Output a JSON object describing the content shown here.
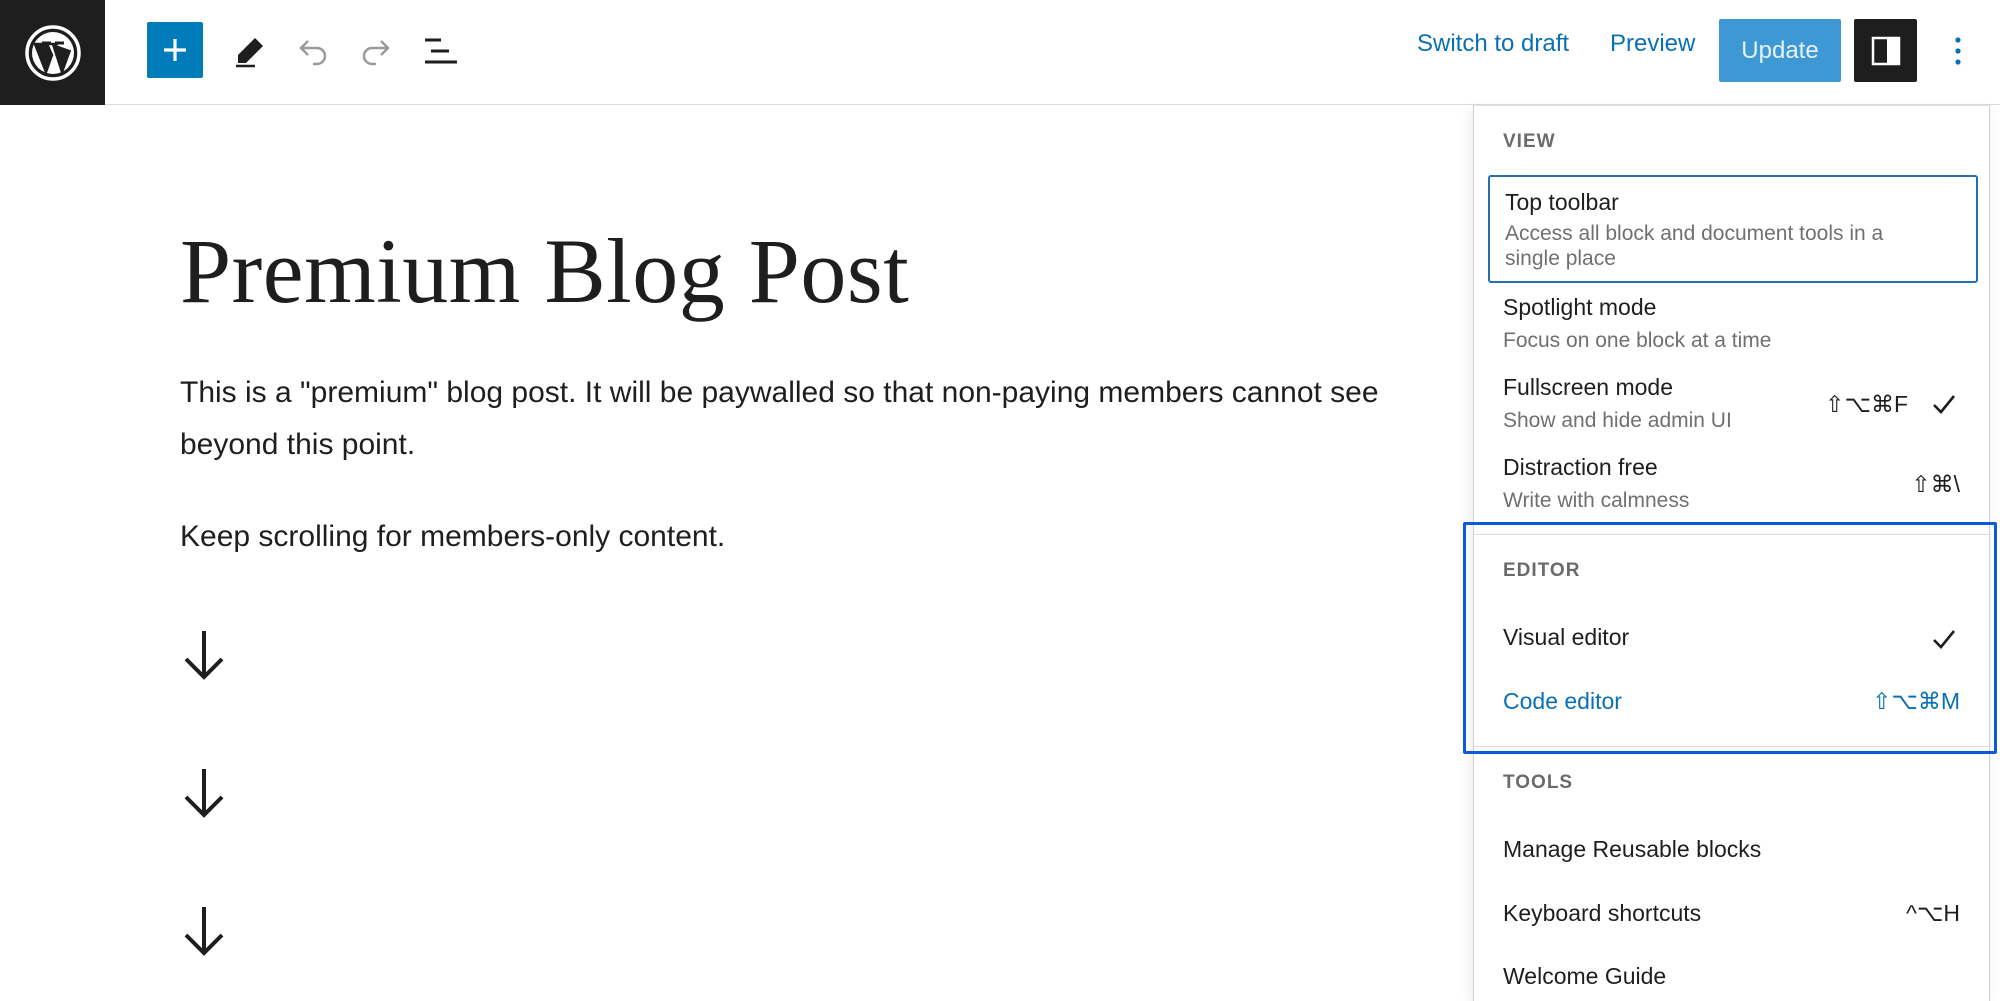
{
  "toolbar": {
    "add_block_icon": "plus-icon",
    "tools_icon": "pencil-icon",
    "undo_icon": "undo-icon",
    "redo_icon": "redo-icon",
    "list_view_icon": "list-view-icon",
    "switch_to_draft": "Switch to draft",
    "preview": "Preview",
    "update": "Update",
    "settings_icon": "sidebar-toggle-icon",
    "options_icon": "more-vertical-icon"
  },
  "post": {
    "title": "Premium Blog Post",
    "paragraphs": [
      "This is a \"premium\" blog post. It will be paywalled so that non-paying members cannot see beyond this point.",
      "Keep scrolling for members-only content."
    ],
    "arrow_icon": "arrow-down-icon"
  },
  "menu": {
    "view": {
      "heading": "VIEW",
      "items": [
        {
          "label": "Top toolbar",
          "desc": "Access all block and document tools in a single place",
          "shortcut": "",
          "checked": false
        },
        {
          "label": "Spotlight mode",
          "desc": "Focus on one block at a time",
          "shortcut": "",
          "checked": false
        },
        {
          "label": "Fullscreen mode",
          "desc": "Show and hide admin UI",
          "shortcut": "⇧⌥⌘F",
          "checked": true
        },
        {
          "label": "Distraction free",
          "desc": "Write with calmness",
          "shortcut": "⇧⌘\\",
          "checked": false
        }
      ]
    },
    "editor": {
      "heading": "EDITOR",
      "items": [
        {
          "label": "Visual editor",
          "shortcut": "",
          "checked": true
        },
        {
          "label": "Code editor",
          "shortcut": "⇧⌥⌘M",
          "checked": false
        }
      ]
    },
    "tools": {
      "heading": "TOOLS",
      "items": [
        {
          "label": "Manage Reusable blocks",
          "shortcut": ""
        },
        {
          "label": "Keyboard shortcuts",
          "shortcut": "^⌥H"
        },
        {
          "label": "Welcome Guide",
          "shortcut": ""
        }
      ]
    }
  },
  "colors": {
    "accent": "#007cba",
    "link": "#0a70b5",
    "highlight": "#0b5bd8",
    "dark": "#1e1e1e"
  }
}
